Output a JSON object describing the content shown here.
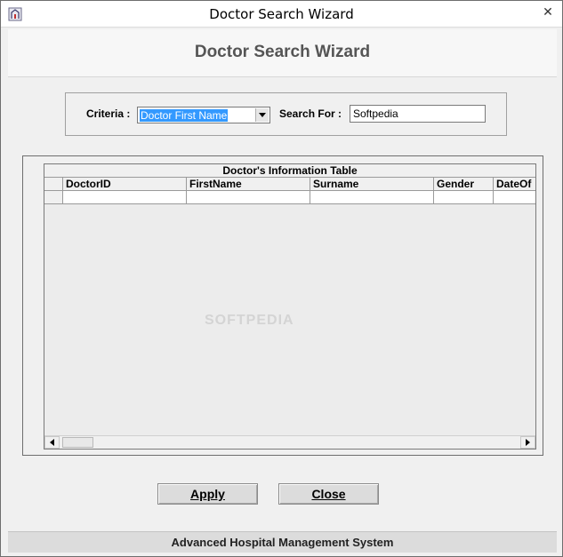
{
  "window": {
    "title": "Doctor Search Wizard",
    "close_glyph": "✕"
  },
  "header": {
    "title": "Doctor Search Wizard"
  },
  "search": {
    "criteria_label": "Criteria :",
    "criteria_selected": "Doctor First Name",
    "search_label": "Search For :",
    "search_value": "Softpedia"
  },
  "table": {
    "caption": "Doctor's Information Table",
    "columns": [
      "DoctorID",
      "FirstName",
      "Surname",
      "Gender",
      "DateOf"
    ]
  },
  "buttons": {
    "apply_label": "Apply",
    "close_label": "Close"
  },
  "footer": {
    "text": "Advanced Hospital Management System"
  },
  "watermark": "SOFTPEDIA",
  "colors": {
    "selection": "#3399ff",
    "window_bg": "#f0f0f0",
    "header_text": "#555555"
  }
}
